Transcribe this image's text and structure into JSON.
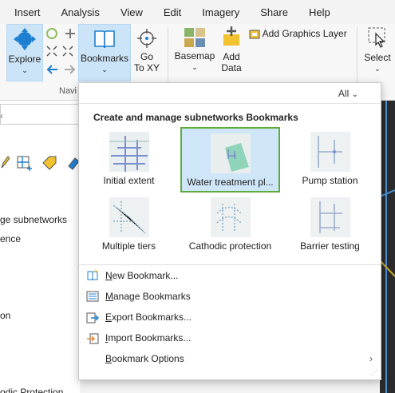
{
  "menu": [
    "Insert",
    "Analysis",
    "View",
    "Edit",
    "Imagery",
    "Share",
    "Help"
  ],
  "ribbon": {
    "explore": "Explore",
    "bookmarks": "Bookmarks",
    "go_to_xy_1": "Go",
    "go_to_xy_2": "To XY",
    "basemap": "Basemap",
    "add_data_1": "Add",
    "add_data_2": "Data",
    "add_graphics_layer": "Add Graphics Layer",
    "select": "Select",
    "navigate_group": "Navi"
  },
  "left_panel": {
    "rows": [
      "ge subnetworks",
      "ence",
      "on",
      "odic Protection"
    ]
  },
  "dropdown": {
    "filter": "All",
    "title": "Create and manage subnetworks Bookmarks",
    "bookmarks": [
      {
        "label": "Initial extent"
      },
      {
        "label": "Water treatment pl..."
      },
      {
        "label": "Pump station"
      },
      {
        "label": "Multiple tiers"
      },
      {
        "label": "Cathodic protection"
      },
      {
        "label": "Barrier testing"
      }
    ],
    "menu_items": [
      {
        "label": "New Bookmark...",
        "underline": "N",
        "rest": "ew Bookmark..."
      },
      {
        "label": "Manage Bookmarks",
        "underline": "M",
        "rest": "anage Bookmarks"
      },
      {
        "label": "Export Bookmarks...",
        "underline": "E",
        "rest": "xport Bookmarks..."
      },
      {
        "label": "Import Bookmarks...",
        "underline": "I",
        "rest": "mport Bookmarks..."
      },
      {
        "label": "Bookmark Options",
        "underline": "B",
        "rest": "ookmark Options"
      }
    ]
  },
  "colors": {
    "active_button": "#cce4f7",
    "selected_border": "#5cab3b",
    "accent_blue": "#1e7fd1"
  }
}
